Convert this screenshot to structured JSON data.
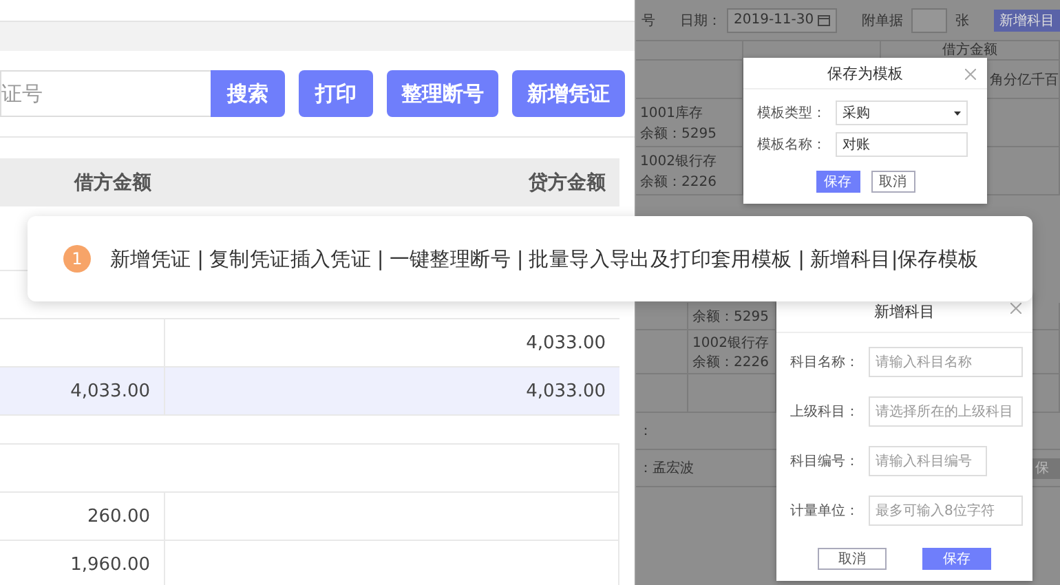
{
  "voucher_list": {
    "search_field": {
      "placeholder": "证号"
    },
    "buttons": [
      "搜索",
      "打印",
      "整理断号",
      "新增凭证"
    ],
    "table": {
      "columns": [
        "借方金额",
        "贷方金额"
      ],
      "rows": [
        {
          "credit": "4,033.00",
          "selected": false
        },
        {
          "debit": "4,033.00",
          "credit": "4,033.00",
          "selected": true
        }
      ]
    },
    "detail_table": {
      "rows": [
        {
          "debit": "260.00"
        },
        {
          "debit": "1,960.00"
        }
      ]
    }
  },
  "background_form": {
    "voucher_no_label": "号",
    "date_label": "日期：",
    "date": "2019-11-30",
    "attachments_label": "附单据",
    "attachments_unit": "张",
    "add_subject_button": "新增科目",
    "debit_header": "借方金额",
    "digit_headers": [
      "角",
      "分",
      "亿",
      "千",
      "百"
    ],
    "entries": [
      {
        "account": "1001库存",
        "balance": "余额：5295"
      },
      {
        "account": "1002银行存",
        "balance": "余额：2226"
      }
    ],
    "lower_entries": [
      {
        "balance": "余额：5295"
      },
      {
        "account": "1002银行存",
        "balance": "余额：2226"
      }
    ],
    "footer_labels": [
      "：",
      "：孟宏波"
    ],
    "cut_button": "保"
  },
  "save_template_dialog": {
    "title": "保存为模板",
    "fields": [
      {
        "kind": "select",
        "label": "模板类型：",
        "value": "采购"
      },
      {
        "kind": "input",
        "label": "模板名称：",
        "value": "对账"
      }
    ],
    "buttons": [
      {
        "label": "保存",
        "primary": true
      },
      {
        "label": "取消",
        "primary": false
      }
    ]
  },
  "add_subject_dialog": {
    "title": "新增科目",
    "fields": [
      {
        "label": "科目名称：",
        "placeholder": "请输入科目名称",
        "short": false
      },
      {
        "label": "上级科目：",
        "placeholder": "请选择所在的上级科目",
        "short": false
      },
      {
        "label": "科目编号：",
        "placeholder": "请输入科目编号",
        "short": true
      },
      {
        "label": "计量单位：",
        "placeholder": "最多可输入8位字符",
        "short": false
      }
    ],
    "buttons": [
      {
        "label": "取消",
        "primary": false
      },
      {
        "label": "保存",
        "primary": true
      }
    ]
  },
  "banner": {
    "number": "1",
    "text": "新增凭证 | 复制凭证插入凭证 | 一键整理断号 | 批量导入导出及打印套用模板 | 新增科目|保存模板"
  }
}
